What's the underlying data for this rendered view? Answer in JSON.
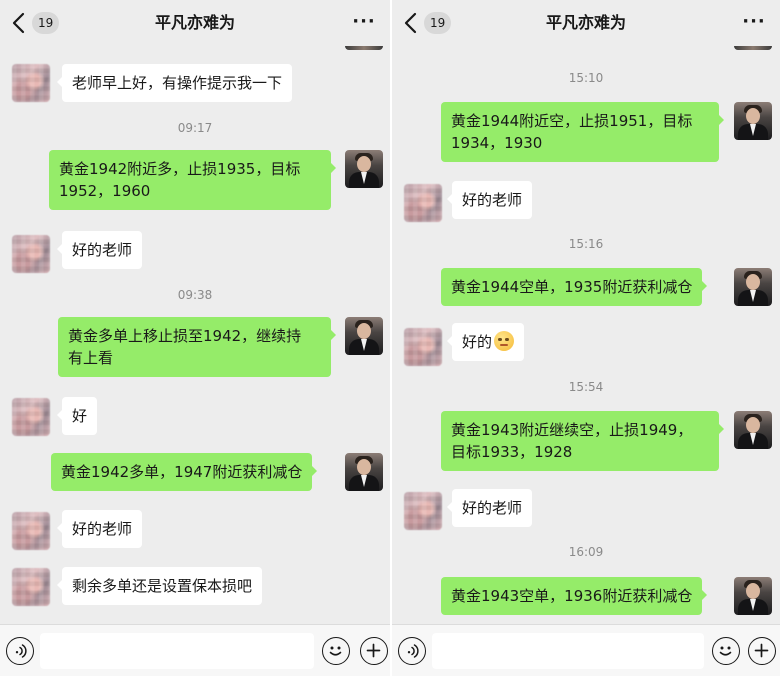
{
  "screens": [
    {
      "header": {
        "badge": "19",
        "title": "平凡亦难为"
      },
      "messages": [
        {
          "text": "老师早上好，有操作提示我一下"
        },
        {
          "timestamp": "09:17"
        },
        {
          "text": "黄金1942附近多，止损1935，目标\n1952，1960"
        },
        {
          "text": "好的老师"
        },
        {
          "timestamp": "09:38"
        },
        {
          "text": "黄金多单上移止损至1942，继续持\n有上看"
        },
        {
          "text": "好"
        },
        {
          "text": "黄金1942多单，1947附近获利减仓"
        },
        {
          "text": "好的老师"
        },
        {
          "text": "剩余多单还是设置保本损吧"
        }
      ]
    },
    {
      "header": {
        "badge": "19",
        "title": "平凡亦难为"
      },
      "messages": [
        {
          "timestamp": "15:10"
        },
        {
          "text": "黄金1944附近空，止损1951，目标\n1934，1930"
        },
        {
          "text": "好的老师"
        },
        {
          "timestamp": "15:16"
        },
        {
          "text": "黄金1944空单，1935附近获利减仓"
        },
        {
          "text": "好的",
          "emoji": "flushed-face-emoji"
        },
        {
          "timestamp": "15:54"
        },
        {
          "text": "黄金1943附近继续空，止损1949，\n目标1933，1928"
        },
        {
          "text": "好的老师"
        },
        {
          "timestamp": "16:09"
        },
        {
          "text": "黄金1943空单，1936附近获利减仓"
        }
      ]
    }
  ],
  "colors": {
    "background": "#ededed",
    "outgoing_bubble": "#95ec69",
    "incoming_bubble": "#ffffff",
    "timestamp_text": "#8a8a8a"
  },
  "icons": [
    "back-chevron-icon",
    "more-icon",
    "voice-icon",
    "emoji-icon",
    "plus-icon"
  ]
}
